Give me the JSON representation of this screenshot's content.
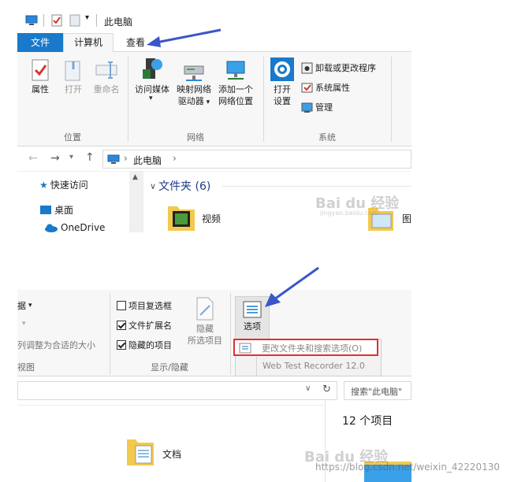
{
  "top": {
    "title": "此电脑",
    "tabs": [
      {
        "label": "文件"
      },
      {
        "label": "计算机"
      },
      {
        "label": "查看"
      }
    ],
    "buttons": {
      "properties": "属性",
      "open": "打开",
      "rename": "重命名",
      "access_media": "访问媒体",
      "map_drive_l1": "映射网络",
      "map_drive_l2": "驱动器",
      "add_location_l1": "添加一个",
      "add_location_l2": "网络位置",
      "open_settings_l1": "打开",
      "open_settings_l2": "设置",
      "uninstall": "卸载或更改程序",
      "system_props": "系统属性",
      "manage": "管理"
    },
    "groups": {
      "location": "位置",
      "network": "网络",
      "system": "系统"
    },
    "address": {
      "path": "此电脑"
    },
    "nav": {
      "quick_access": "快速访问",
      "desktop": "桌面",
      "onedrive": "OneDrive"
    },
    "content": {
      "section": "文件夹 (6)",
      "video": "视频",
      "pictures_partial": "图"
    }
  },
  "bottom": {
    "partial_label": "据",
    "partial_resize": "列调整为合适的大小",
    "view_label": "视图",
    "item_checkboxes": "项目复选框",
    "file_ext": "文件扩展名",
    "hidden_items": "隐藏的项目",
    "hide_l1": "隐藏",
    "hide_l2": "所选项目",
    "options": "选项",
    "show_hide_group": "显示/隐藏",
    "menu_change": "更改文件夹和搜索选项(O)",
    "menu_recorder": "Web Test Recorder 12.0",
    "search_placeholder": "搜索\"此电脑\"",
    "item_count": "12 个项目",
    "documents": "文档"
  },
  "watermarks": {
    "baidu1": "Bai du 经验",
    "baidu1_sub": "jingyan.baidu.com",
    "baidu2": "Bai du 经验",
    "csdn": "https://blog.csdn.net/weixin_42220130"
  },
  "colors": {
    "file_tab": "#1979ca",
    "arrow": "#3a56c8",
    "highlight": "#e03030"
  }
}
